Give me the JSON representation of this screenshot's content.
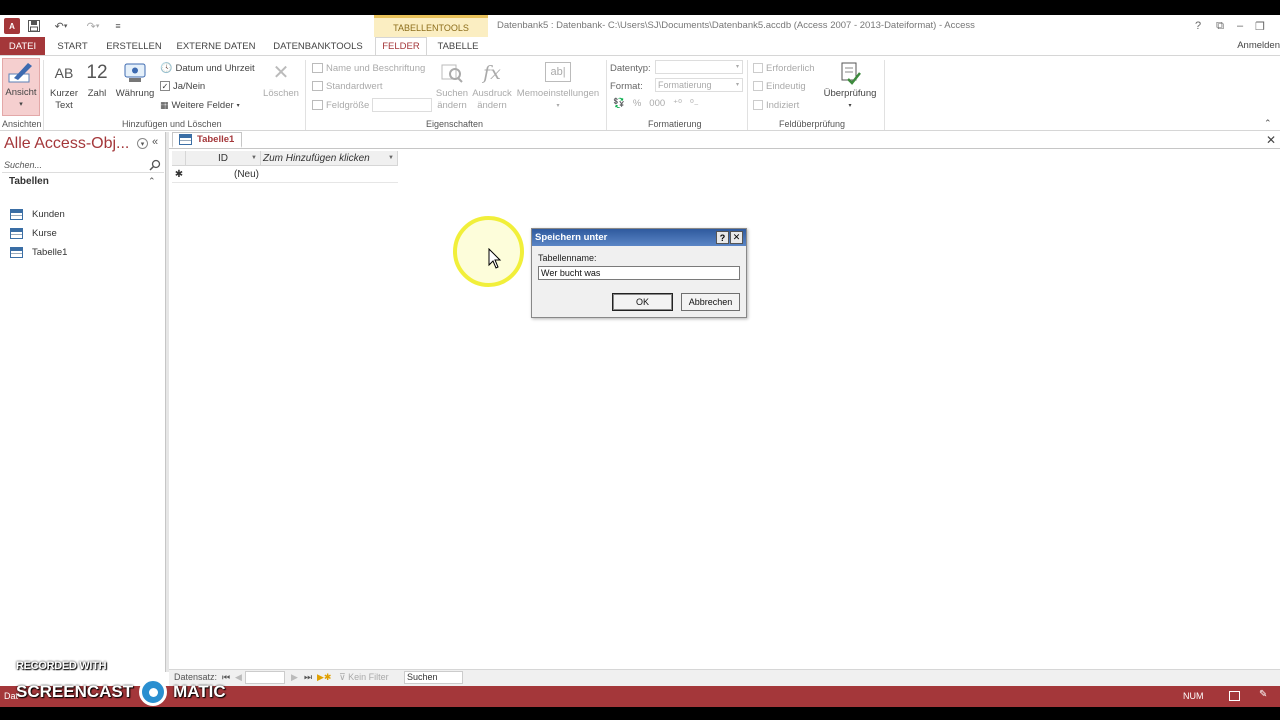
{
  "window": {
    "app_icon": "A",
    "title": "Datenbank5 : Datenbank- C:\\Users\\SJ\\Documents\\Datenbank5.accdb (Access 2007 - 2013-Dateiformat) - Access",
    "contextual_group": "TABELLENTOOLS",
    "help": "?",
    "sign_in": "Anmelden"
  },
  "tabs": {
    "file": "DATEI",
    "start": "START",
    "create": "ERSTELLEN",
    "external": "EXTERNE DATEN",
    "dbtools": "DATENBANKTOOLS",
    "fields": "FELDER",
    "table": "TABELLE"
  },
  "ribbon": {
    "views": {
      "view": "Ansicht",
      "group": "Ansichten"
    },
    "add_delete": {
      "short_text_icon": "AB",
      "short_text_1": "Kurzer",
      "short_text_2": "Text",
      "number_icon": "12",
      "number": "Zahl",
      "currency": "Währung",
      "datetime": "Datum und Uhrzeit",
      "yesno": "Ja/Nein",
      "more_fields": "Weitere Felder",
      "delete": "Löschen",
      "group": "Hinzufügen und Löschen"
    },
    "properties": {
      "name_caption": "Name und Beschriftung",
      "default_value": "Standardwert",
      "field_size": "Feldgröße",
      "lookup_1": "Suchen",
      "lookup_2": "ändern",
      "expression_icon": "fx",
      "expression_1": "Ausdruck",
      "expression_2": "ändern",
      "memo_icon": "ab|",
      "memo": "Memoeinstellungen",
      "group": "Eigenschaften"
    },
    "formatting": {
      "datatype_label": "Datentyp:",
      "format_label": "Format:",
      "format_value": "Formatierung",
      "percent": "%",
      "thousands": "000",
      "group": "Formatierung"
    },
    "validation": {
      "required": "Erforderlich",
      "unique": "Eindeutig",
      "indexed": "Indiziert",
      "validation": "Überprüfung",
      "group": "Feldüberprüfung"
    }
  },
  "nav_pane": {
    "title": "Alle Access-Obj...",
    "search_placeholder": "Suchen...",
    "section": "Tabellen",
    "items": [
      {
        "label": "Kunden"
      },
      {
        "label": "Kurse"
      },
      {
        "label": "Tabelle1"
      }
    ]
  },
  "document": {
    "tab_label": "Tabelle1",
    "columns": [
      "ID",
      "Zum Hinzufügen klicken"
    ],
    "new_row_marker": "✱",
    "new_row_value": "(Neu)"
  },
  "dialog": {
    "title": "Speichern unter",
    "help": "?",
    "close": "✕",
    "label": "Tabellenname:",
    "input_value": "Wer bucht was",
    "ok": "OK",
    "cancel": "Abbrechen"
  },
  "record_nav": {
    "label": "Datensatz:",
    "no_filter": "Kein Filter",
    "search": "Suchen"
  },
  "status_bar": {
    "left": "Dat",
    "num": "NUM"
  },
  "watermark": {
    "line1": "RECORDED WITH",
    "line2a": "SCREENCAST",
    "line2b": "MATIC"
  },
  "colors": {
    "access_accent": "#a4373a",
    "contextual_tab_bg": "#fbeec2",
    "dialog_title": "#2f5a9e",
    "cursor_highlight": "#f1ef3a"
  }
}
